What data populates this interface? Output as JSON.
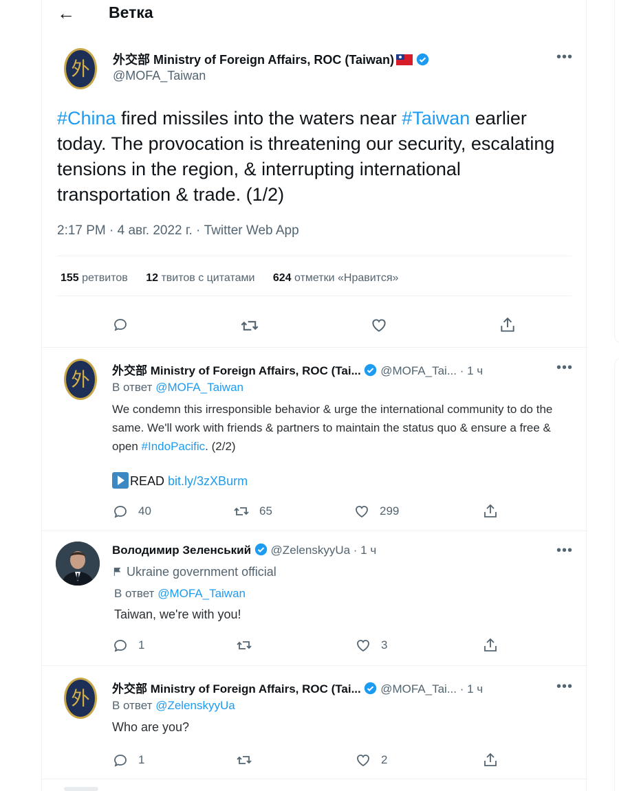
{
  "header": {
    "back_icon": "arrow-left-icon",
    "title": "Ветка"
  },
  "main_tweet": {
    "author_name": "外交部 Ministry of Foreign Affairs, ROC (Taiwan)",
    "handle": "@MOFA_Taiwan",
    "text_parts": {
      "hashtag1": "#China",
      "t1": " fired missiles into the waters near ",
      "hashtag2": "#Taiwan",
      "t2": " earlier today. The provocation is threatening our security, escalating tensions in the region, & interrupting international transportation & trade. (1/2)"
    },
    "meta": "2:17 PM · 4 авг. 2022 г. · Twitter Web App",
    "stats": {
      "retweets_count": "155",
      "retweets_label": "ретвитов",
      "quotes_count": "12",
      "quotes_label": "твитов с цитатами",
      "likes_count": "624",
      "likes_label": "отметки «Нравится»"
    }
  },
  "replies": [
    {
      "author_name": "外交部 Ministry of Foreign Affairs, ROC (Tai...",
      "handle": "@MOFA_Tai...",
      "time": "· 1 ч",
      "reply_prefix": "В ответ",
      "reply_to": "@MOFA_Taiwan",
      "text_a": "We condemn this irresponsible behavior & urge the international community to do the same. We'll work with friends & partners to maintain the status quo & ensure a free & open ",
      "hashtag": "#IndoPacific",
      "text_b": ". (2/2)",
      "read_label": "READ",
      "read_link": "bit.ly/3zXBurm",
      "replies": "40",
      "retweets": "65",
      "likes": "299"
    },
    {
      "author_name": "Володимир Зеленський",
      "handle": "@ZelenskyyUa",
      "time": "· 1 ч",
      "label": "Ukraine government official",
      "reply_prefix": "В ответ",
      "reply_to": "@MOFA_Taiwan",
      "text": "Taiwan, we're with you!",
      "replies": "1",
      "likes": "3"
    },
    {
      "author_name": "外交部 Ministry of Foreign Affairs, ROC (Tai...",
      "handle": "@MOFA_Tai...",
      "time": "· 1 ч",
      "reply_prefix": "В ответ",
      "reply_to": "@ZelenskyyUa",
      "text": "Who are you?",
      "replies": "1",
      "likes": "2"
    }
  ],
  "colors": {
    "link": "#1d9bf0",
    "muted": "#536471",
    "text": "#0f1419",
    "verified": "#1d9bf0"
  }
}
